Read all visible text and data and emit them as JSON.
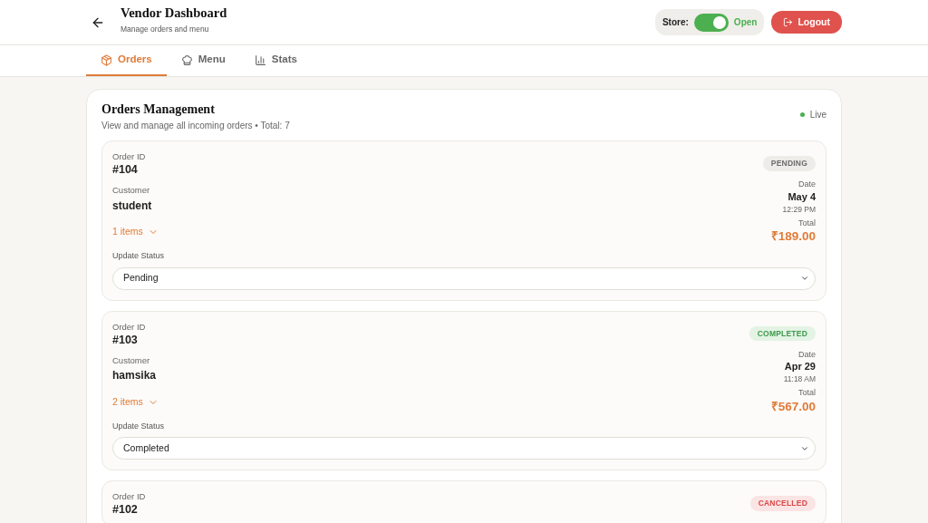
{
  "header": {
    "title": "Vendor Dashboard",
    "subtitle": "Manage orders and menu",
    "store_label": "Store:",
    "store_toggle": {
      "on": true,
      "label": "Open"
    },
    "logout": "Logout"
  },
  "tabs": [
    {
      "label": "Orders",
      "selected": true
    },
    {
      "label": "Menu",
      "selected": false
    },
    {
      "label": "Stats",
      "selected": false
    }
  ],
  "orders_panel": {
    "title": "Orders Management",
    "subtitle": "View and manage all incoming orders • Total: 7",
    "live": "Live",
    "orders": [
      {
        "id_label": "Order ID",
        "id": "#104",
        "status": {
          "kind": "pending",
          "label": "PENDING"
        },
        "customer_label": "Customer",
        "customer": "student",
        "date_label": "Date",
        "date": "May 4",
        "time": "12:29 PM",
        "items": "1 items",
        "total_label": "Total",
        "total": "₹189.00",
        "update_label": "Update Status",
        "update_value": "Pending"
      },
      {
        "id_label": "Order ID",
        "id": "#103",
        "status": {
          "kind": "completed",
          "label": "COMPLETED"
        },
        "customer_label": "Customer",
        "customer": "hamsika",
        "date_label": "Date",
        "date": "Apr 29",
        "time": "11:18 AM",
        "items": "2 items",
        "total_label": "Total",
        "total": "₹567.00",
        "update_label": "Update Status",
        "update_value": "Completed"
      },
      {
        "id_label": "Order ID",
        "id": "#102",
        "status": {
          "kind": "cancelled",
          "label": "CANCELLED"
        }
      }
    ]
  }
}
